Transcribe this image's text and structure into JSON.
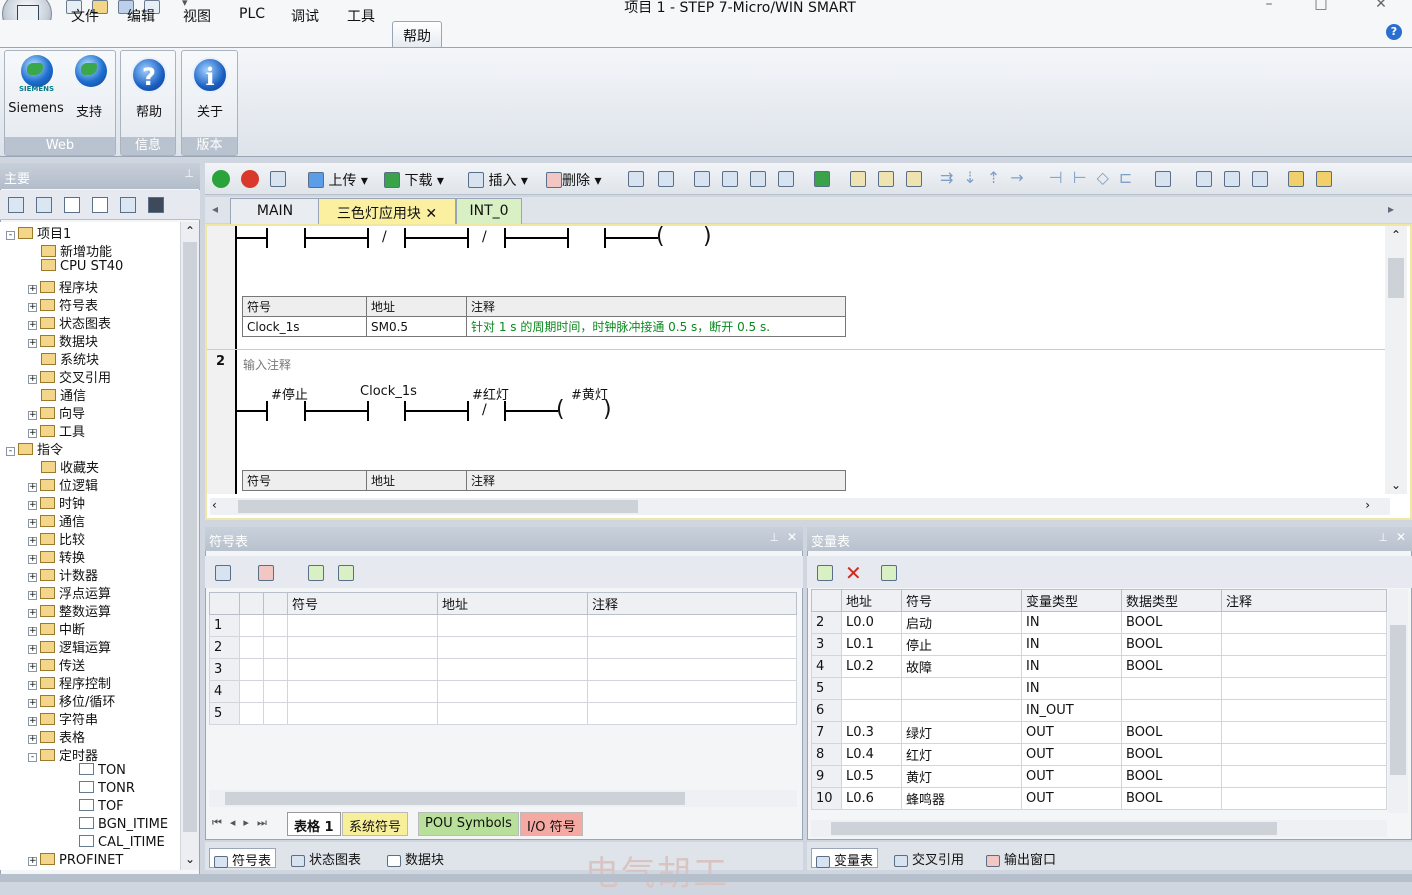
{
  "window": {
    "title": "项目 1 - STEP 7-Micro/WIN SMART"
  },
  "menu": [
    "文件",
    "编辑",
    "视图",
    "PLC",
    "调试",
    "工具",
    "帮助"
  ],
  "ribbon": {
    "groups": [
      {
        "name": "Web",
        "buttons": [
          "Siemens",
          "支持"
        ]
      },
      {
        "name": "信息",
        "buttons": [
          "帮助"
        ]
      },
      {
        "name": "版本",
        "buttons": [
          "关于"
        ]
      }
    ],
    "siemens_logo_text": "SIEMENS"
  },
  "left_panel": {
    "title": "主要",
    "tree": [
      {
        "label": "项目1",
        "level": 0,
        "exp": "-"
      },
      {
        "label": "新增功能",
        "level": 1
      },
      {
        "label": "CPU ST40",
        "level": 1
      },
      {
        "label": "程序块",
        "level": 1,
        "exp": "+"
      },
      {
        "label": "符号表",
        "level": 1,
        "exp": "+"
      },
      {
        "label": "状态图表",
        "level": 1,
        "exp": "+"
      },
      {
        "label": "数据块",
        "level": 1,
        "exp": "+"
      },
      {
        "label": "系统块",
        "level": 1
      },
      {
        "label": "交叉引用",
        "level": 1,
        "exp": "+"
      },
      {
        "label": "通信",
        "level": 1
      },
      {
        "label": "向导",
        "level": 1,
        "exp": "+"
      },
      {
        "label": "工具",
        "level": 1,
        "exp": "+"
      },
      {
        "label": "指令",
        "level": 0,
        "exp": "-"
      },
      {
        "label": "收藏夹",
        "level": 1
      },
      {
        "label": "位逻辑",
        "level": 1,
        "exp": "+"
      },
      {
        "label": "时钟",
        "level": 1,
        "exp": "+"
      },
      {
        "label": "通信",
        "level": 1,
        "exp": "+"
      },
      {
        "label": "比较",
        "level": 1,
        "exp": "+"
      },
      {
        "label": "转换",
        "level": 1,
        "exp": "+"
      },
      {
        "label": "计数器",
        "level": 1,
        "exp": "+"
      },
      {
        "label": "浮点运算",
        "level": 1,
        "exp": "+"
      },
      {
        "label": "整数运算",
        "level": 1,
        "exp": "+"
      },
      {
        "label": "中断",
        "level": 1,
        "exp": "+"
      },
      {
        "label": "逻辑运算",
        "level": 1,
        "exp": "+"
      },
      {
        "label": "传送",
        "level": 1,
        "exp": "+"
      },
      {
        "label": "程序控制",
        "level": 1,
        "exp": "+"
      },
      {
        "label": "移位/循环",
        "level": 1,
        "exp": "+"
      },
      {
        "label": "字符串",
        "level": 1,
        "exp": "+"
      },
      {
        "label": "表格",
        "level": 1,
        "exp": "+"
      },
      {
        "label": "定时器",
        "level": 1,
        "exp": "-"
      },
      {
        "label": "TON",
        "level": 2
      },
      {
        "label": "TONR",
        "level": 2
      },
      {
        "label": "TOF",
        "level": 2
      },
      {
        "label": "BGN_ITIME",
        "level": 2
      },
      {
        "label": "CAL_ITIME",
        "level": 2
      },
      {
        "label": "PROFINET",
        "level": 1,
        "exp": "+"
      }
    ]
  },
  "editor_toolbar": {
    "upload": "上传",
    "download": "下载",
    "insert": "插入",
    "delete": "删除"
  },
  "editor_tabs": [
    "MAIN",
    "三色灯应用块",
    "INT_0"
  ],
  "ladder": {
    "network1": {
      "symbol_table": {
        "headers": [
          "符号",
          "地址",
          "注释"
        ],
        "rows": [
          [
            "Clock_1s",
            "SM0.5",
            "针对 1 s 的周期时间，时钟脉冲接通 0.5 s，断开 0.5 s."
          ]
        ]
      }
    },
    "network2": {
      "number": "2",
      "comment": "输入注释",
      "operands": [
        "#停止",
        "Clock_1s",
        "#红灯",
        "#黄灯"
      ],
      "symbol_table_headers": [
        "符号",
        "地址",
        "注释"
      ]
    },
    "slash": "/",
    "coil_open": "(",
    "coil_close": ")"
  },
  "symbol_panel": {
    "title": "符号表",
    "headers": [
      "符号",
      "地址",
      "注释"
    ],
    "rows": [
      "1",
      "2",
      "3",
      "4",
      "5"
    ],
    "tabs": [
      "表格 1",
      "系统符号",
      "POU Symbols",
      "I/O 符号"
    ]
  },
  "var_panel": {
    "title": "变量表",
    "headers": [
      "地址",
      "符号",
      "变量类型",
      "数据类型",
      "注释"
    ],
    "rows": [
      [
        "2",
        "L0.0",
        "启动",
        "IN",
        "BOOL"
      ],
      [
        "3",
        "L0.1",
        "停止",
        "IN",
        "BOOL"
      ],
      [
        "4",
        "L0.2",
        "故障",
        "IN",
        "BOOL"
      ],
      [
        "5",
        "",
        "",
        "IN",
        ""
      ],
      [
        "6",
        "",
        "",
        "IN_OUT",
        ""
      ],
      [
        "7",
        "L0.3",
        "绿灯",
        "OUT",
        "BOOL"
      ],
      [
        "8",
        "L0.4",
        "红灯",
        "OUT",
        "BOOL"
      ],
      [
        "9",
        "L0.5",
        "黄灯",
        "OUT",
        "BOOL"
      ],
      [
        "10",
        "L0.6",
        "蜂鸣器",
        "OUT",
        "BOOL"
      ]
    ]
  },
  "bottom_left_tabs": [
    "符号表",
    "状态图表",
    "数据块"
  ],
  "bottom_right_tabs": [
    "变量表",
    "交叉引用",
    "输出窗口"
  ],
  "watermark": "电气胡工"
}
